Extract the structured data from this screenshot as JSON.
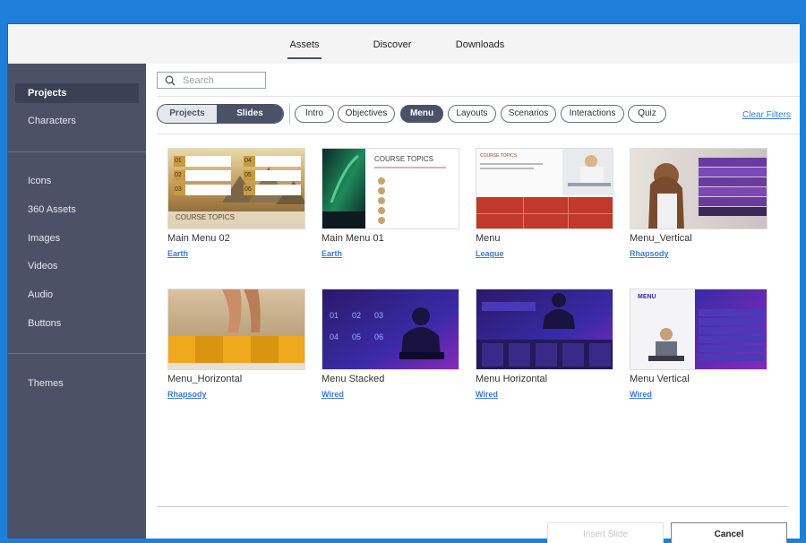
{
  "top_tabs": [
    {
      "label": "Assets",
      "active": true
    },
    {
      "label": "Discover",
      "active": false
    },
    {
      "label": "Downloads",
      "active": false
    }
  ],
  "sidebar": {
    "items": [
      {
        "label": "Projects",
        "active": true
      },
      {
        "label": "Characters"
      },
      {
        "label": "Icons"
      },
      {
        "label": "360 Assets"
      },
      {
        "label": "Images"
      },
      {
        "label": "Videos"
      },
      {
        "label": "Audio"
      },
      {
        "label": "Buttons"
      },
      {
        "label": "Themes"
      }
    ]
  },
  "search": {
    "placeholder": "Search"
  },
  "toggle": {
    "left_label": "Projects",
    "right_label": "Slides",
    "selected": "Slides"
  },
  "filters": [
    {
      "label": "Intro"
    },
    {
      "label": "Objectives"
    },
    {
      "label": "Menu",
      "active": true
    },
    {
      "label": "Layouts"
    },
    {
      "label": "Scenarios"
    },
    {
      "label": "Interactions"
    },
    {
      "label": "Quiz"
    }
  ],
  "clear_filters": "Clear Filters",
  "cards": [
    {
      "title": "Main Menu 02",
      "theme": "Earth"
    },
    {
      "title": "Main Menu 01",
      "theme": "Earth"
    },
    {
      "title": "Menu",
      "theme": "League"
    },
    {
      "title": "Menu_Vertical",
      "theme": "Rhapsody"
    },
    {
      "title": "Menu_Horizontal",
      "theme": "Rhapsody"
    },
    {
      "title": "Menu Stacked",
      "theme": "Wired"
    },
    {
      "title": "Menu Horizontal",
      "theme": "Wired"
    },
    {
      "title": "Menu Vertical",
      "theme": "Wired"
    }
  ],
  "thumb_text": {
    "course_topics_upper": "COURSE TOPICS",
    "course_topics_lower": "Course Topics",
    "menu_label": "MENU",
    "n01": "01",
    "n02": "02",
    "n03": "03",
    "n04": "04",
    "n05": "05",
    "n06": "06"
  },
  "footer": {
    "insert_label": "Insert Slide",
    "cancel_label": "Cancel"
  },
  "colors": {
    "sidebar": "#4b5268",
    "accent": "#3a7bd5",
    "window_border": "#1e7fd8"
  }
}
